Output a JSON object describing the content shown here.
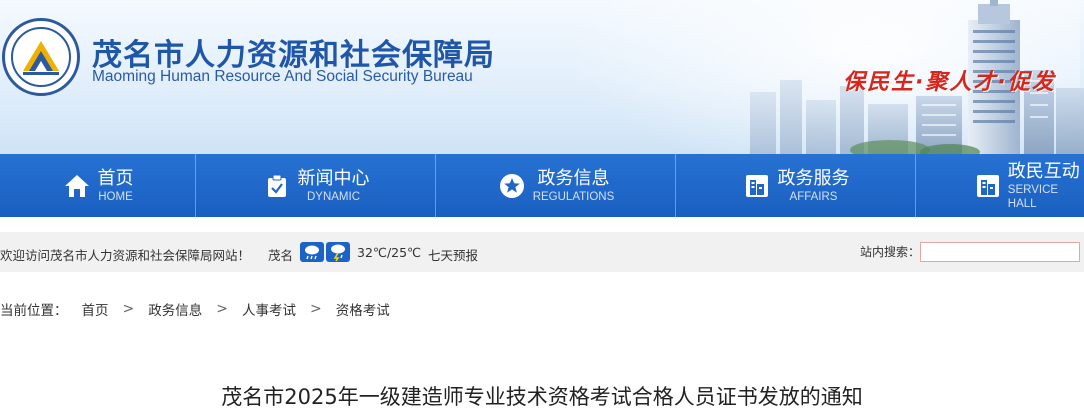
{
  "header": {
    "site_name_cn": "茂名市人力资源和社会保障局",
    "site_name_en": "Maoming Human Resource And Social Security Bureau",
    "slogan": "保民生·聚人才·促发",
    "colors": {
      "brand": "#1f56a8",
      "nav": "#1f66c9",
      "slogan": "#d8261c"
    }
  },
  "nav": {
    "items": [
      {
        "label": "首页",
        "sub": "HOME",
        "icon": "home-icon"
      },
      {
        "label": "新闻中心",
        "sub": "DYNAMIC",
        "icon": "clipboard-check-icon"
      },
      {
        "label": "政务信息",
        "sub": "REGULATIONS",
        "icon": "star-circle-icon"
      },
      {
        "label": "政务服务",
        "sub": "AFFAIRS",
        "icon": "building-icon"
      },
      {
        "label": "政民互动",
        "sub": "SERVICE HALL",
        "icon": "building-icon"
      }
    ]
  },
  "infobar": {
    "welcome": "欢迎访问茂名市人力资源和社会保障局网站！",
    "city": "茂名",
    "weather_icons": [
      "rain-icon",
      "thunderstorm-icon"
    ],
    "temperature": "32℃/25℃",
    "forecast_link": "七天预报",
    "search_label": "站内搜索："
  },
  "breadcrumb": {
    "label": "当前位置：",
    "items": [
      "首页",
      "政务信息",
      "人事考试",
      "资格考试"
    ]
  },
  "article": {
    "title": "茂名市2025年一级建造师专业技术资格考试合格人员证书发放的通知"
  }
}
